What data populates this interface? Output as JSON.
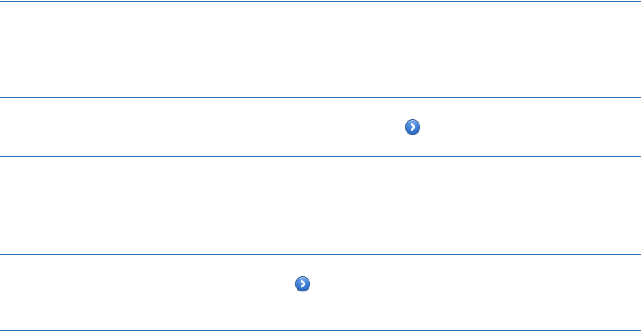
{
  "rows": [
    {
      "name": "row-1"
    },
    {
      "name": "row-2",
      "has_disclosure": true
    },
    {
      "name": "row-3"
    },
    {
      "name": "row-4",
      "has_disclosure": true
    }
  ],
  "icons": {
    "disclosure": "chevron-right-icon"
  },
  "colors": {
    "rule": "#2f75b5",
    "disclosure": "#3f7fd6",
    "background": "#ffffff"
  }
}
